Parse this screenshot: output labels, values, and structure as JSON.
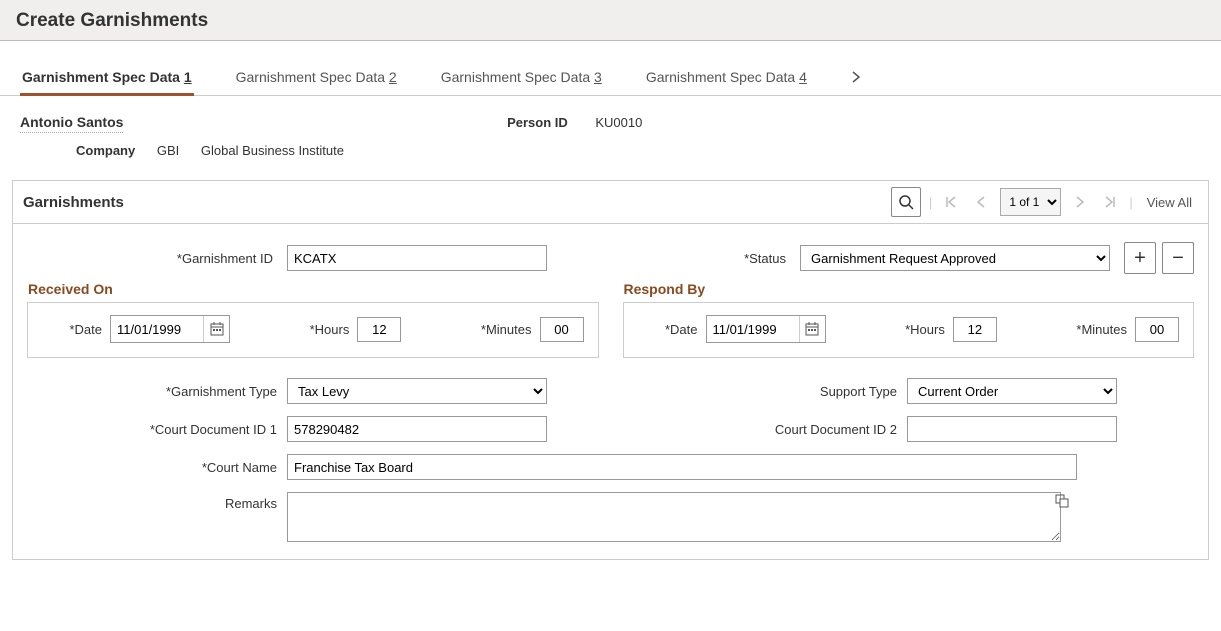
{
  "header": {
    "title": "Create Garnishments"
  },
  "tabs": [
    {
      "prefix": "Garnishment Spec Data ",
      "num": "1",
      "active": true
    },
    {
      "prefix": "Garnishment Spec Data ",
      "num": "2",
      "active": false
    },
    {
      "prefix": "Garnishment Spec Data ",
      "num": "3",
      "active": false
    },
    {
      "prefix": "Garnishment Spec Data ",
      "num": "4",
      "active": false
    }
  ],
  "person": {
    "name": "Antonio Santos",
    "person_id_label": "Person ID",
    "person_id": "KU0010",
    "company_label": "Company",
    "company_code": "GBI",
    "company_name": "Global Business Institute"
  },
  "section": {
    "title": "Garnishments",
    "pager": "1 of 1",
    "viewall": "View All"
  },
  "labels": {
    "garnishment_id": "Garnishment ID",
    "status": "Status",
    "received_on": "Received On",
    "respond_by": "Respond By",
    "date": "Date",
    "hours": "Hours",
    "minutes": "Minutes",
    "garnishment_type": "Garnishment Type",
    "support_type": "Support Type",
    "court_doc1": "Court Document ID 1",
    "court_doc2": "Court Document ID 2",
    "court_name": "Court Name",
    "remarks": "Remarks"
  },
  "values": {
    "garnishment_id": "KCATX",
    "status": "Garnishment Request Approved",
    "received_date": "11/01/1999",
    "received_hours": "12",
    "received_minutes": "00",
    "respond_date": "11/01/1999",
    "respond_hours": "12",
    "respond_minutes": "00",
    "garnishment_type": "Tax Levy",
    "support_type": "Current Order",
    "court_doc1": "578290482",
    "court_doc2": "",
    "court_name": "Franchise Tax Board",
    "remarks": ""
  },
  "icons": {
    "plus": "+",
    "minus": "−"
  }
}
